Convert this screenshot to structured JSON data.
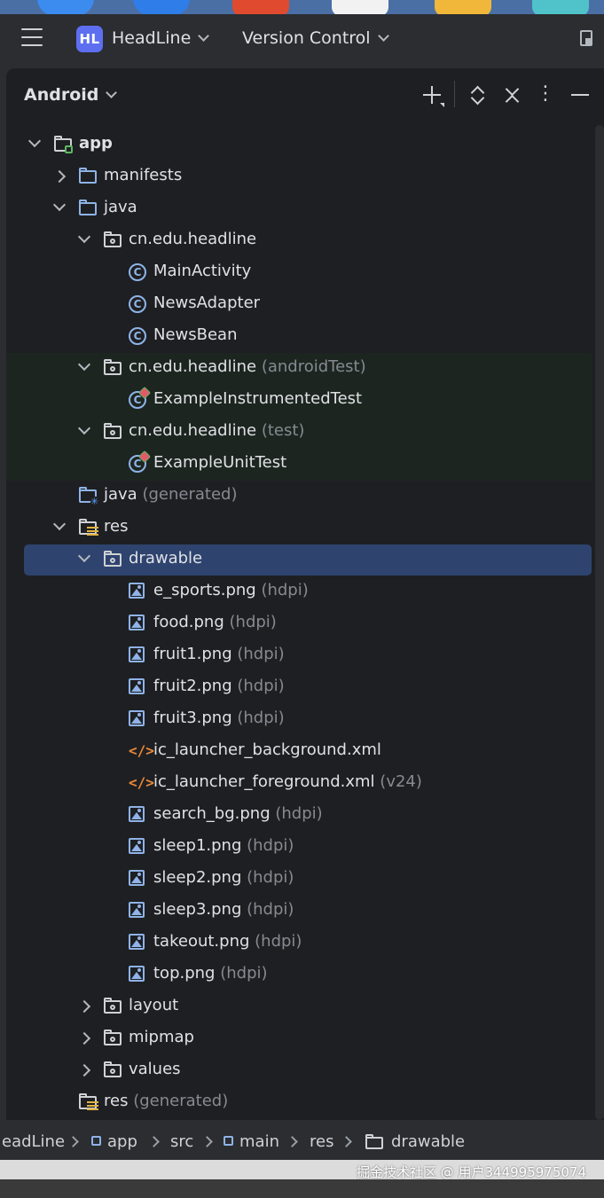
{
  "titlebar": {
    "project_badge": "HL",
    "project_name": "HeadLine",
    "vcs_label": "Version Control"
  },
  "panel": {
    "view_mode": "Android",
    "header_icons": [
      "plus-icon",
      "expand-all-icon",
      "collapse-all-icon",
      "more-options-icon",
      "minimize-icon"
    ]
  },
  "tree": [
    {
      "indent": 0,
      "arrow": "down",
      "icon": "module-icon",
      "label": "app",
      "sub": "",
      "bold": true
    },
    {
      "indent": 1,
      "arrow": "right",
      "icon": "folder-icon",
      "label": "manifests",
      "sub": ""
    },
    {
      "indent": 1,
      "arrow": "down",
      "icon": "folder-icon",
      "label": "java",
      "sub": ""
    },
    {
      "indent": 2,
      "arrow": "down",
      "icon": "package-icon",
      "label": "cn.edu.headline",
      "sub": ""
    },
    {
      "indent": 3,
      "arrow": "",
      "icon": "class-icon",
      "label": "MainActivity",
      "sub": ""
    },
    {
      "indent": 3,
      "arrow": "",
      "icon": "class-icon",
      "label": "NewsAdapter",
      "sub": ""
    },
    {
      "indent": 3,
      "arrow": "",
      "icon": "class-icon",
      "label": "NewsBean",
      "sub": ""
    },
    {
      "indent": 2,
      "arrow": "down",
      "icon": "package-icon",
      "label": "cn.edu.headline",
      "sub": "(androidTest)",
      "test": true
    },
    {
      "indent": 3,
      "arrow": "",
      "icon": "test-class-icon",
      "label": "ExampleInstrumentedTest",
      "sub": "",
      "test": true
    },
    {
      "indent": 2,
      "arrow": "down",
      "icon": "package-icon",
      "label": "cn.edu.headline",
      "sub": "(test)",
      "test": true
    },
    {
      "indent": 3,
      "arrow": "",
      "icon": "test-class-icon",
      "label": "ExampleUnitTest",
      "sub": "",
      "test": true
    },
    {
      "indent": 1,
      "arrow": "",
      "icon": "generated-java-icon",
      "label": "java",
      "sub": "(generated)"
    },
    {
      "indent": 1,
      "arrow": "down",
      "icon": "res-icon",
      "label": "res",
      "sub": ""
    },
    {
      "indent": 2,
      "arrow": "down",
      "icon": "package-icon",
      "label": "drawable",
      "sub": "",
      "selected": true
    },
    {
      "indent": 3,
      "arrow": "",
      "icon": "image-icon",
      "label": "e_sports.png",
      "sub": "(hdpi)"
    },
    {
      "indent": 3,
      "arrow": "",
      "icon": "image-icon",
      "label": "food.png",
      "sub": "(hdpi)"
    },
    {
      "indent": 3,
      "arrow": "",
      "icon": "image-icon",
      "label": "fruit1.png",
      "sub": "(hdpi)"
    },
    {
      "indent": 3,
      "arrow": "",
      "icon": "image-icon",
      "label": "fruit2.png",
      "sub": "(hdpi)"
    },
    {
      "indent": 3,
      "arrow": "",
      "icon": "image-icon",
      "label": "fruit3.png",
      "sub": "(hdpi)"
    },
    {
      "indent": 3,
      "arrow": "",
      "icon": "xml-icon",
      "label": "ic_launcher_background.xml",
      "sub": ""
    },
    {
      "indent": 3,
      "arrow": "",
      "icon": "xml-icon",
      "label": "ic_launcher_foreground.xml",
      "sub": "(v24)"
    },
    {
      "indent": 3,
      "arrow": "",
      "icon": "image-icon",
      "label": "search_bg.png",
      "sub": "(hdpi)"
    },
    {
      "indent": 3,
      "arrow": "",
      "icon": "image-icon",
      "label": "sleep1.png",
      "sub": "(hdpi)"
    },
    {
      "indent": 3,
      "arrow": "",
      "icon": "image-icon",
      "label": "sleep2.png",
      "sub": "(hdpi)"
    },
    {
      "indent": 3,
      "arrow": "",
      "icon": "image-icon",
      "label": "sleep3.png",
      "sub": "(hdpi)"
    },
    {
      "indent": 3,
      "arrow": "",
      "icon": "image-icon",
      "label": "takeout.png",
      "sub": "(hdpi)"
    },
    {
      "indent": 3,
      "arrow": "",
      "icon": "image-icon",
      "label": "top.png",
      "sub": "(hdpi)"
    },
    {
      "indent": 2,
      "arrow": "right",
      "icon": "package-icon",
      "label": "layout",
      "sub": ""
    },
    {
      "indent": 2,
      "arrow": "right",
      "icon": "package-icon",
      "label": "mipmap",
      "sub": ""
    },
    {
      "indent": 2,
      "arrow": "right",
      "icon": "package-icon",
      "label": "values",
      "sub": ""
    },
    {
      "indent": 1,
      "arrow": "",
      "icon": "res-icon",
      "label": "res",
      "sub": "(generated)"
    }
  ],
  "breadcrumb": {
    "project": "eadLine",
    "module": "app",
    "src": "src",
    "main": "main",
    "res": "res",
    "drawable": "drawable"
  },
  "watermark": "掘金技术社区 @ 用户344995975074",
  "colors": {
    "selection": "#2e436e",
    "accent": "#5d6ff0",
    "folder": "#8fb3e8",
    "xml": "#e88a3a"
  }
}
